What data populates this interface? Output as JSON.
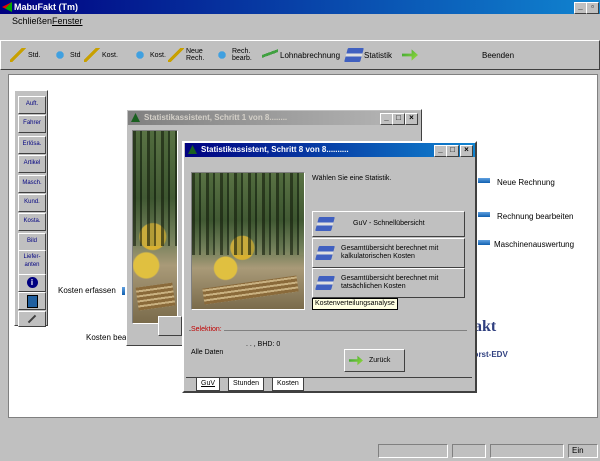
{
  "app": {
    "title": "MabuFakt (Tm)"
  },
  "menu": {
    "schliessen": "Schließen",
    "fenster": "Fenster"
  },
  "toolbar": {
    "std1": "Std.",
    "std2": "Std",
    "kost1": "Kost.",
    "kost2": "Kost.",
    "neue_rech": "Neue Rech.",
    "rech_bearb": "Rech. bearb.",
    "lohnabrechnung": "Lohnabrechnung",
    "statistik": "Statistik",
    "beenden": "Beenden"
  },
  "sidebar": {
    "items": [
      "Auft.",
      "Fahrer",
      "Erlösa.",
      "Artikel",
      "Masch.",
      "Kund.",
      "Kosta.",
      "Bild",
      "Liefer-anten"
    ]
  },
  "main": {
    "kosten_erfassen": "Kosten erfassen",
    "kosten_bea": "Kosten bea",
    "neue_rechnung": "Neue Rechnung",
    "rechnung_bearbeiten": "Rechnung bearbeiten",
    "maschinenauswertung": "Maschinenauswertung",
    "brand_fakt": "akt",
    "brand_sub": "-Forst-EDV"
  },
  "dialog1": {
    "title": "Statistikassistent, Schritt 1 von 8........"
  },
  "dialog8": {
    "title": "Statistikassistent, Schritt 8 von 8..........",
    "prompt": "Wählen Sie eine Statistik.",
    "btn_guv": "GuV - Schnellübersicht",
    "btn_kalk": "Gesamtübersicht berechnet mit kalkulatorischen Kosten",
    "btn_tats": "Gesamtübersicht berechnet mit tatsächlichen Kosten",
    "tooltip": "Kostenverteilungsanalyse",
    "selektion_label": "Selektion:",
    "selektion_value": "Alle Daten",
    "selektion_dots": ". . , BHD: 0",
    "zurueck": "Zurück",
    "tabs": [
      "GuV",
      "Stunden",
      "Kosten"
    ]
  },
  "statusbar": {
    "ein": "Ein"
  }
}
